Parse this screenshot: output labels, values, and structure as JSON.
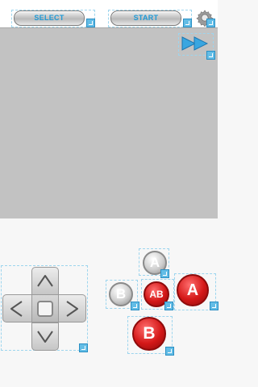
{
  "topbar": {
    "select_label": "SELECT",
    "start_label": "START"
  },
  "icons": {
    "settings": "gear-icon",
    "fast_forward": "fast-forward-icon",
    "resize": "resize-handle-icon"
  },
  "controls": {
    "a_label": "A",
    "b_label": "B",
    "ab_label": "AB",
    "turbo_a_label": "A",
    "turbo_b_label": "B"
  },
  "colors": {
    "accent": "#1f9ad6",
    "screen": "#c2c2c2",
    "button_red": "#d41818",
    "handle": "#63bde6"
  }
}
